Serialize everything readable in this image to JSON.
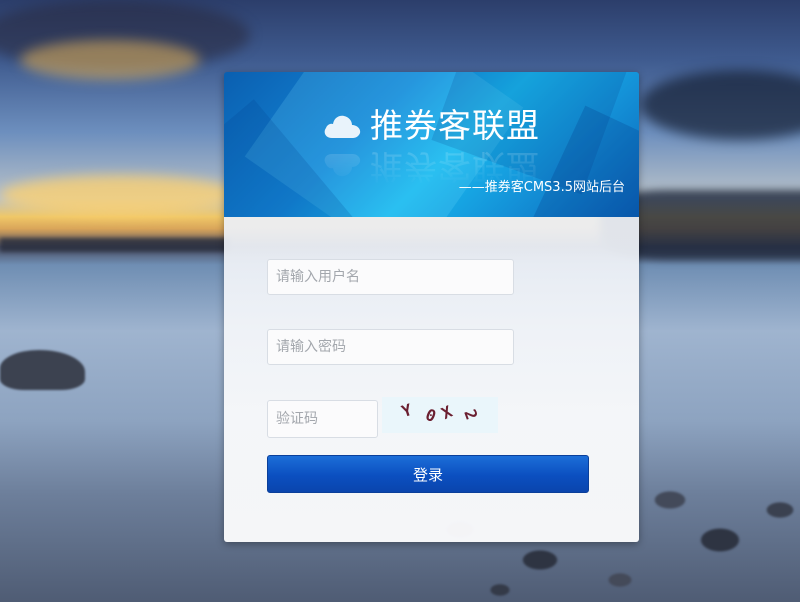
{
  "brand": {
    "title": "推券客联盟",
    "subtitle": "——推券客CMS3.5网站后台",
    "icon": "cloud-icon"
  },
  "form": {
    "username_placeholder": "请输入用户名",
    "password_placeholder": "请输入密码",
    "captcha_placeholder": "验证码",
    "captcha_text": [
      "Y",
      "0",
      "X",
      "2"
    ],
    "login_label": "登录"
  },
  "colors": {
    "header_dark": "#0a5fb0",
    "header_light": "#19b8ee",
    "button": "#0b4fc0",
    "captcha_chars": "#6b1f30"
  }
}
